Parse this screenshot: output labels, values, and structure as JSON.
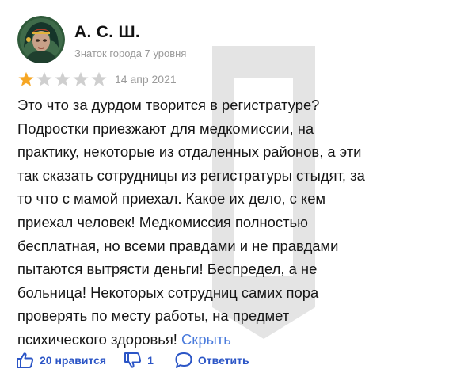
{
  "author": {
    "name": "А. С. Ш.",
    "level": "Знаток города 7 уровня"
  },
  "rating": {
    "value": 1,
    "max": 5,
    "date": "14 апр 2021"
  },
  "colors": {
    "star_filled": "#f6a623",
    "star_empty": "#cfcfcf",
    "accent": "#2b55c6",
    "link": "#4a7bdc"
  },
  "review": {
    "lines": [
      "Это что за дурдом творится в регистратуре?",
      "Подростки приезжают для медкомиссии, на",
      "практику, некоторые из отдаленных районов, а эти",
      "так сказать сотрудницы из регистратуры стыдят, за",
      "то что с мамой приехал. Какое их дело, с кем",
      "приехал человек! Медкомиссия полностью",
      "бесплатная, но всеми правдами и не правдами",
      "пытаются вытрясти деньги! Беспредел, а не",
      "больница! Некоторых сотрудниц самих пора",
      "проверять по месту работы, на предмет",
      "психического здоровья!"
    ],
    "hide_label": "Скрыть"
  },
  "actions": {
    "like_label": "20 нравится",
    "dislike_label": "1",
    "reply_label": "Ответить"
  }
}
